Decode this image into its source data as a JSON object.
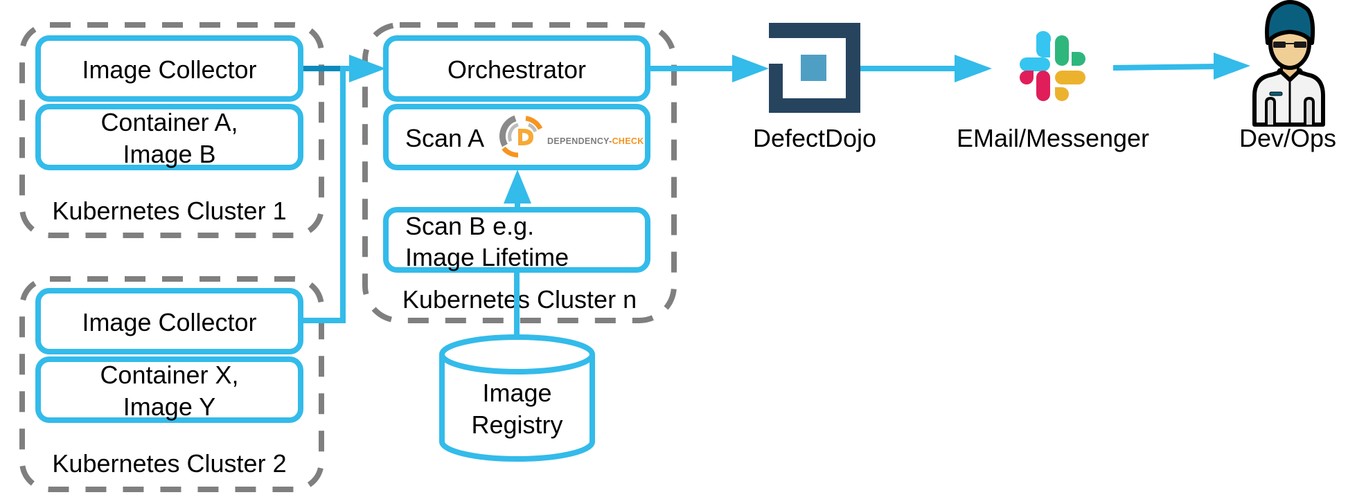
{
  "diagram": {
    "clusters": [
      {
        "id": "cluster-1",
        "label": "Kubernetes Cluster 1"
      },
      {
        "id": "cluster-2",
        "label": "Kubernetes Cluster 2"
      },
      {
        "id": "cluster-n",
        "label": "Kubernetes Cluster n"
      }
    ],
    "nodes": {
      "image_collector_1": {
        "label": "Image Collector"
      },
      "container_a": {
        "line1": "Container A,",
        "line2": "Image B"
      },
      "image_collector_2": {
        "label": "Image Collector"
      },
      "container_x": {
        "line1": "Container X,",
        "line2": "Image Y"
      },
      "orchestrator": {
        "label": "Orchestrator"
      },
      "scan_a": {
        "label": "Scan A",
        "logo_text_gray": "DEPENDENCY-",
        "logo_text_orange": "CHECK"
      },
      "scan_b": {
        "line1": "Scan B e.g.",
        "line2": "Image Lifetime"
      },
      "image_registry": {
        "line1": "Image",
        "line2": "Registry"
      },
      "defectdojo": {
        "label": "DefectDojo",
        "icon": "defectdojo-logo-icon"
      },
      "messenger": {
        "label": "EMail/Messenger",
        "icon": "slack-logo-icon"
      },
      "devops": {
        "label": "Dev/Ops",
        "icon": "person-icon"
      }
    },
    "edges": [
      {
        "from": "image_collector_1",
        "to": "orchestrator"
      },
      {
        "from": "image_collector_2",
        "to": "orchestrator"
      },
      {
        "from": "scan_b",
        "to": "scan_a"
      },
      {
        "from": "image_registry",
        "to": "scan_b"
      },
      {
        "from": "orchestrator",
        "to": "defectdojo"
      },
      {
        "from": "defectdojo",
        "to": "messenger"
      },
      {
        "from": "messenger",
        "to": "devops"
      }
    ],
    "colors": {
      "box_stroke": "#33bbea",
      "cluster_stroke": "#7f7f7f",
      "defectdojo_dark": "#27445f",
      "defectdojo_light": "#4f9fc4",
      "depcheck_gray": "#7d7d7d",
      "depcheck_orange": "#f7941e",
      "slack_blue": "#36c5f0",
      "slack_green": "#2eb67d",
      "slack_red": "#e01e5a",
      "slack_yellow": "#ecb22e"
    }
  }
}
